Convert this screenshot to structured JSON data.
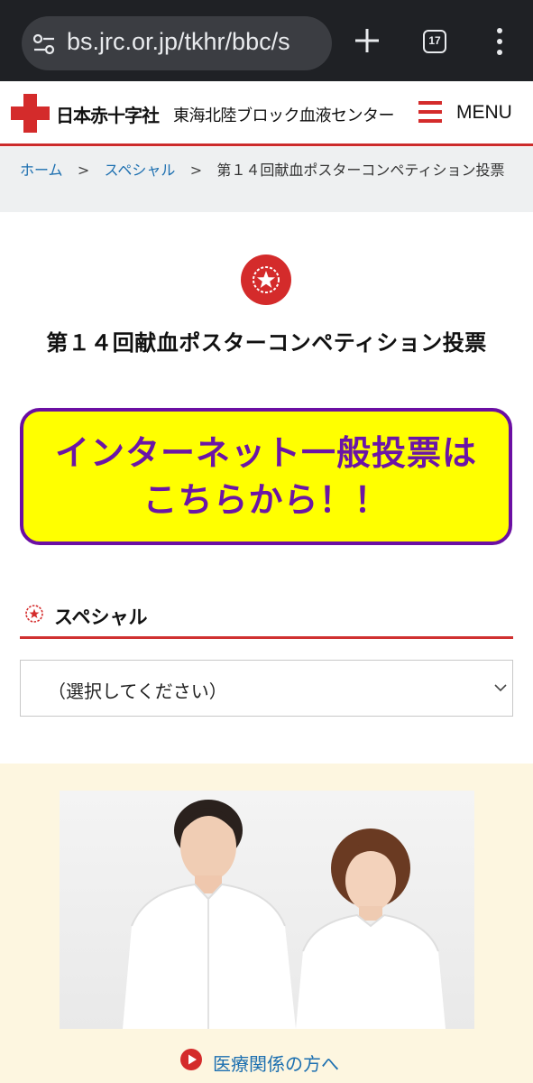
{
  "browser": {
    "url": "bs.jrc.or.jp/tkhr/bbc/s",
    "tab_count": "17"
  },
  "header": {
    "org_name": "日本赤十字社",
    "center_name": "東海北陸ブロック血液センター",
    "menu_label": "MENU"
  },
  "breadcrumb": {
    "home": "ホーム",
    "separator": ">",
    "special": "スペシャル",
    "current": "第１４回献血ポスターコンペティション投票"
  },
  "page": {
    "title": "第１４回献血ポスターコンペティション投票"
  },
  "banner": {
    "line1": "インターネット一般投票は",
    "line2": "こちらから！！"
  },
  "special_section": {
    "heading": "スペシャル",
    "select_value": "（選択してください）"
  },
  "promo": {
    "link_label": "医療関係の方へ"
  },
  "colors": {
    "brand_red": "#d42b2b",
    "banner_yellow": "#ffff00",
    "banner_purple": "#6b15a6",
    "link_blue": "#1c6fb0",
    "beige": "#fdf6e0"
  }
}
